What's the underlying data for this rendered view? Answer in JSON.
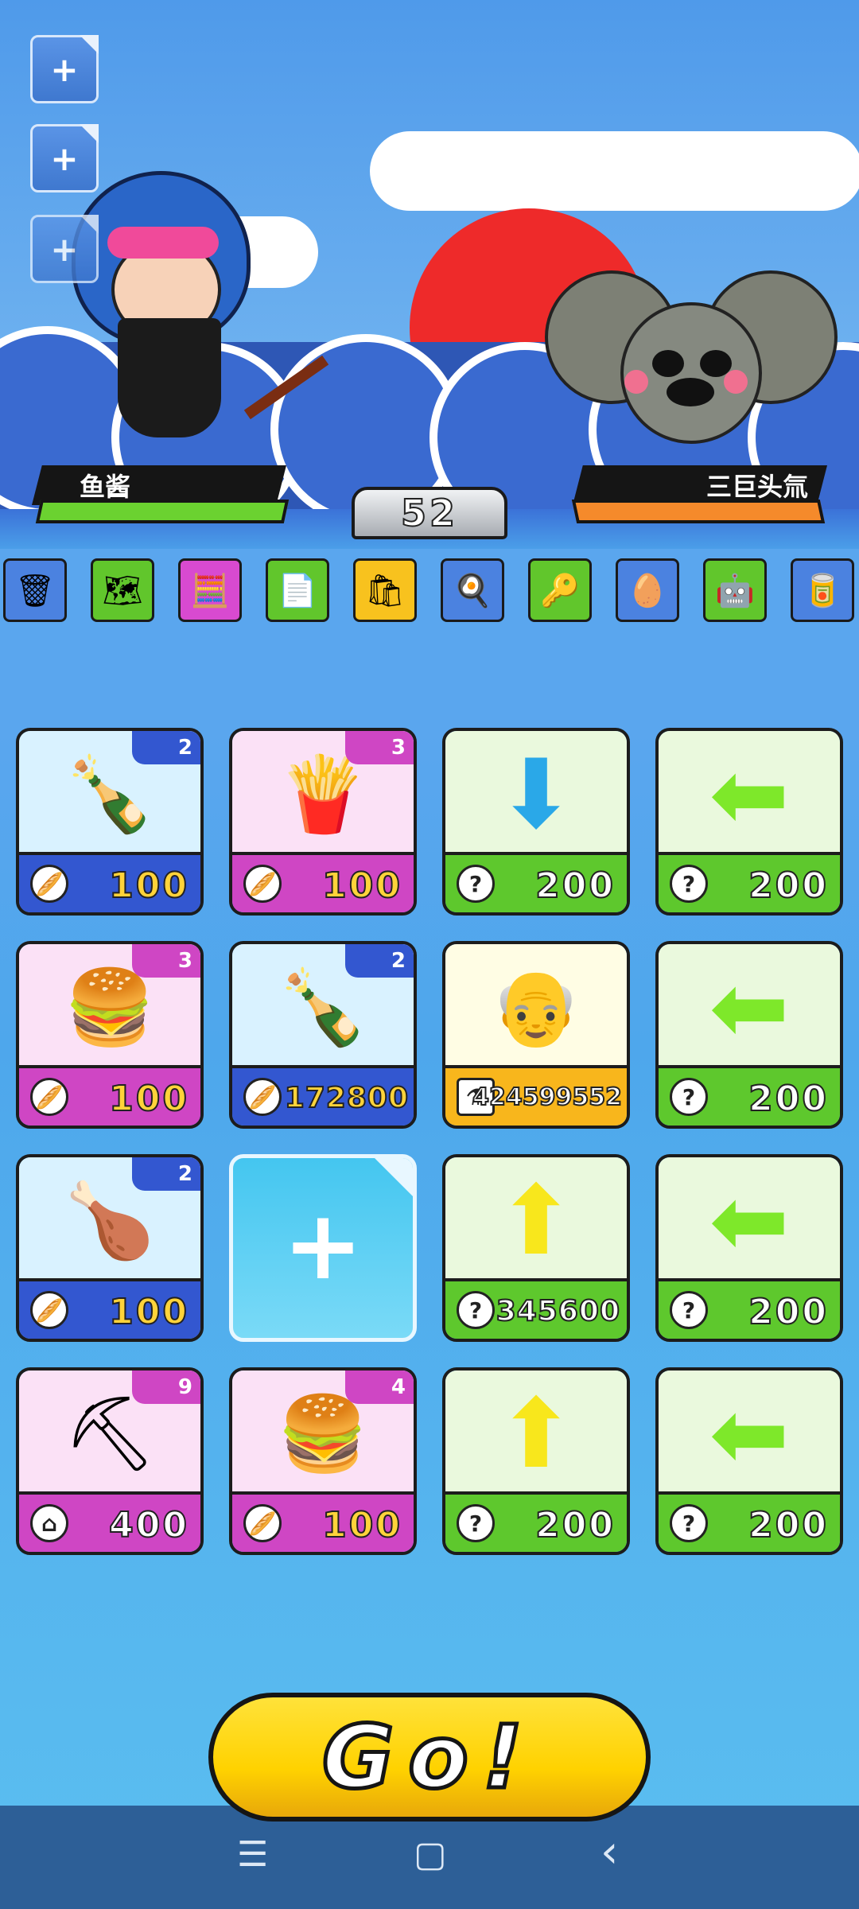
{
  "side_buttons": [
    "+",
    "+",
    "+"
  ],
  "player": {
    "name": "鱼酱",
    "hp_color": "#6bd230"
  },
  "enemy": {
    "name": "三巨头氚",
    "hp_color": "#f58a2b"
  },
  "round": "52",
  "items": [
    {
      "icon": "trash-icon",
      "glyph": "🗑"
    },
    {
      "icon": "map-icon",
      "glyph": "🗺"
    },
    {
      "icon": "calculator-icon",
      "glyph": "🧮"
    },
    {
      "icon": "document-icon",
      "glyph": "📄"
    },
    {
      "icon": "bag-icon",
      "glyph": "🛍"
    },
    {
      "icon": "pan-icon",
      "glyph": "🍳"
    },
    {
      "icon": "key-icon",
      "glyph": "🔑"
    },
    {
      "icon": "nest-icon",
      "glyph": "🥚"
    },
    {
      "icon": "robot-icon",
      "glyph": "🤖"
    },
    {
      "icon": "can-icon",
      "glyph": "🥫"
    }
  ],
  "cards": [
    {
      "name": "cola",
      "style": "blue",
      "glyph": "🍾",
      "level": "2",
      "cost_icon": "bread",
      "price": "100"
    },
    {
      "name": "fries",
      "style": "pink",
      "glyph": "🍟",
      "level": "3",
      "cost_icon": "bread",
      "price": "100"
    },
    {
      "name": "arrow-down",
      "style": "green",
      "glyph": "⬇",
      "level": "",
      "cost_icon": "?",
      "price": "200"
    },
    {
      "name": "arrow-left",
      "style": "green",
      "glyph": "⬅",
      "level": "",
      "cost_icon": "?",
      "price": "200"
    },
    {
      "name": "burger",
      "style": "pink",
      "glyph": "🍔",
      "level": "3",
      "cost_icon": "bread",
      "price": "100"
    },
    {
      "name": "cola",
      "style": "blue",
      "glyph": "🍾",
      "level": "2",
      "cost_icon": "bread",
      "price": "172800"
    },
    {
      "name": "professor",
      "style": "yellow",
      "glyph": "👴",
      "level": "",
      "cost_icon": "lab",
      "price": "424599552"
    },
    {
      "name": "arrow-left",
      "style": "green",
      "glyph": "⬅",
      "level": "",
      "cost_icon": "?",
      "price": "200"
    },
    {
      "name": "chicken-leg",
      "style": "blue",
      "glyph": "🍗",
      "level": "2",
      "cost_icon": "bread",
      "price": "100"
    },
    {
      "name": "empty-slot",
      "style": "empty",
      "glyph": "+",
      "level": "",
      "cost_icon": "",
      "price": ""
    },
    {
      "name": "arrow-up",
      "style": "green",
      "glyph": "⬆",
      "level": "",
      "cost_icon": "?",
      "price": "345600"
    },
    {
      "name": "arrow-left",
      "style": "green",
      "glyph": "⬅",
      "level": "",
      "cost_icon": "?",
      "price": "200"
    },
    {
      "name": "mine",
      "style": "pink",
      "glyph": "⛏",
      "level": "9",
      "cost_icon": "home",
      "price": "400"
    },
    {
      "name": "burger",
      "style": "pink",
      "glyph": "🍔",
      "level": "4",
      "cost_icon": "bread",
      "price": "100"
    },
    {
      "name": "arrow-up",
      "style": "green",
      "glyph": "⬆",
      "level": "",
      "cost_icon": "?",
      "price": "200"
    },
    {
      "name": "arrow-left",
      "style": "green",
      "glyph": "⬅",
      "level": "",
      "cost_icon": "?",
      "price": "200"
    }
  ],
  "go_label": "Go!",
  "nav": {
    "menu": "☰",
    "home": "▢",
    "back": "‹"
  }
}
